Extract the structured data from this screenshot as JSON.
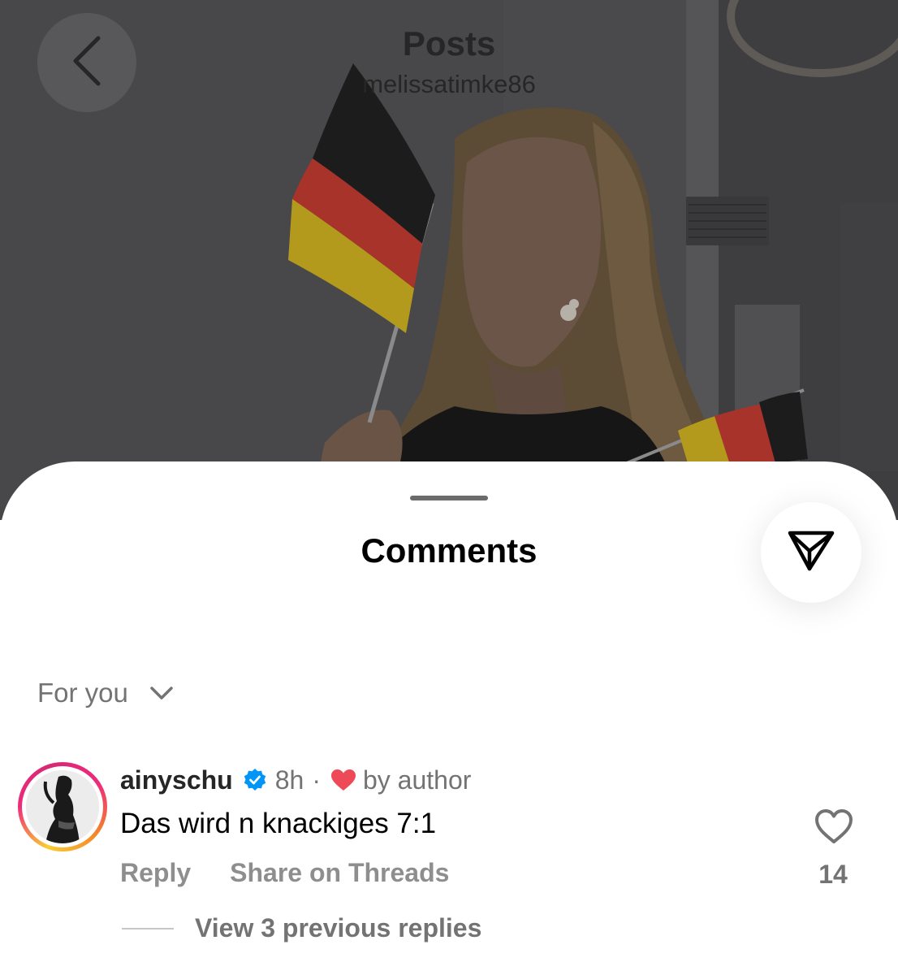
{
  "header": {
    "title": "Posts",
    "username": "melissatimke86"
  },
  "sheet": {
    "title": "Comments"
  },
  "sort": {
    "label": "For you"
  },
  "comment": {
    "username": "ainyschu",
    "time": "8h",
    "separator": "·",
    "liked_by": "by author",
    "text": "Das wird n knackiges 7:1",
    "reply_label": "Reply",
    "share_threads_label": "Share on Threads",
    "like_count": "14",
    "view_replies_label": "View 3 previous replies"
  },
  "icons": {
    "back": "chevron-left-icon",
    "share": "paper-plane-icon",
    "sort": "chevron-down-icon",
    "verified": "verified-badge-icon",
    "author_heart": "heart-filled-icon",
    "like": "heart-outline-icon"
  },
  "colors": {
    "verified_blue": "#0095f6",
    "heart_red": "#ed4956",
    "muted_text": "#737373",
    "flag_black": "#1c1c1c",
    "flag_red": "#c0392b",
    "flag_gold": "#d4b21e"
  }
}
